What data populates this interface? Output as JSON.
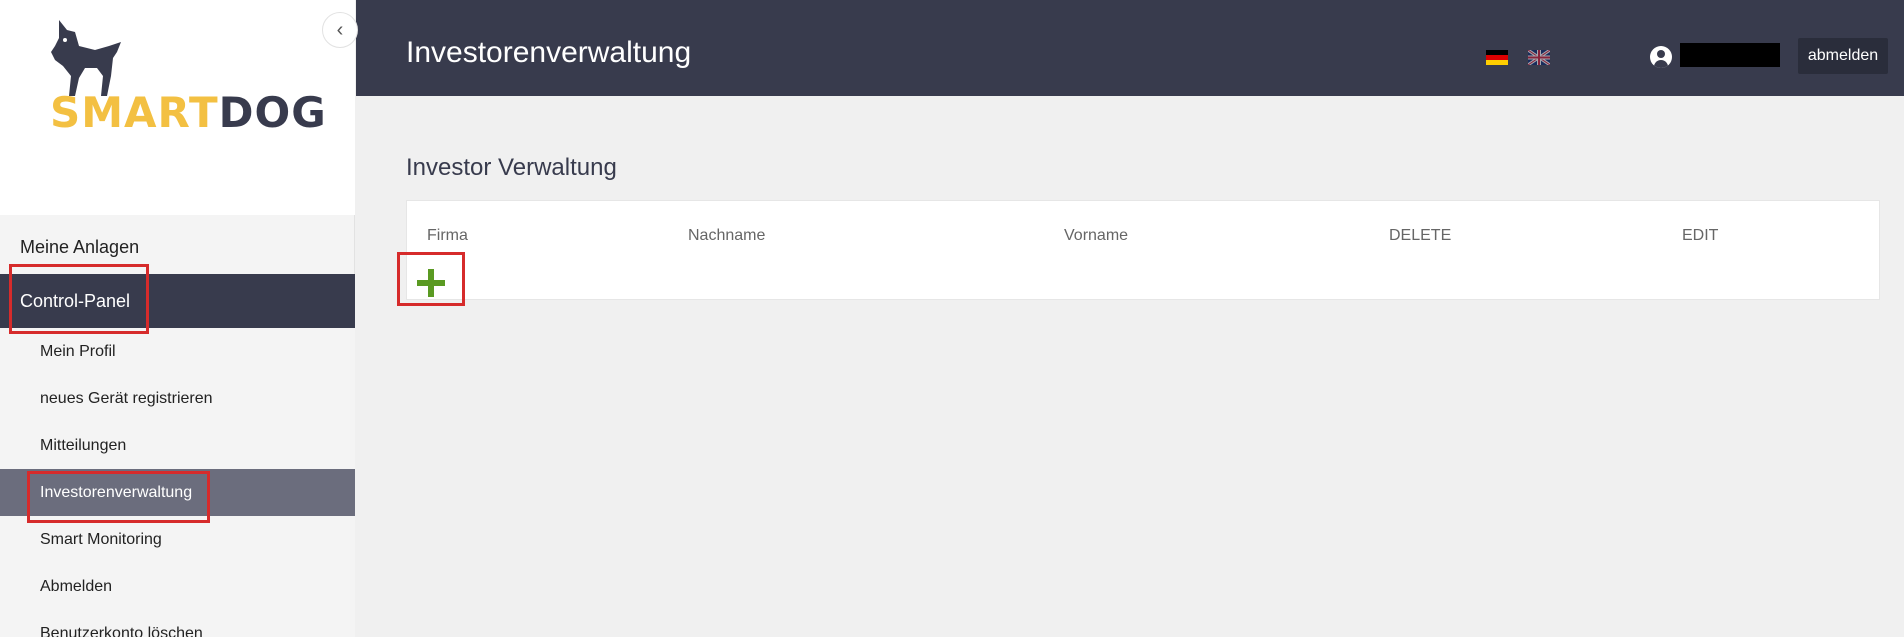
{
  "app": {
    "brand": {
      "part1": "SMART",
      "part2": "DOG"
    },
    "page_title": "Investorenverwaltung"
  },
  "header": {
    "languages": [
      {
        "code": "de",
        "icon": "german-flag-icon"
      },
      {
        "code": "en",
        "icon": "uk-flag-icon"
      }
    ],
    "logout_label": "abmelden"
  },
  "sidebar": {
    "top_item": "Meine Anlagen",
    "section": "Control-Panel",
    "items": [
      {
        "label": "Mein Profil"
      },
      {
        "label": "neues Gerät registrieren"
      },
      {
        "label": "Mitteilungen"
      },
      {
        "label": "Investorenverwaltung",
        "active": true
      },
      {
        "label": "Smart Monitoring"
      },
      {
        "label": "Abmelden"
      },
      {
        "label": "Benutzerkonto löschen"
      }
    ]
  },
  "main": {
    "section_title": "Investor Verwaltung",
    "table": {
      "columns": [
        "Firma",
        "Nachname",
        "Vorname",
        "DELETE",
        "EDIT"
      ],
      "rows": []
    }
  },
  "colors": {
    "dark": "#383b4d",
    "accent_yellow": "#f3c042",
    "active_item": "#6b6d7d",
    "add_green": "#5a9a22",
    "annotation_red": "#d62b2b"
  }
}
